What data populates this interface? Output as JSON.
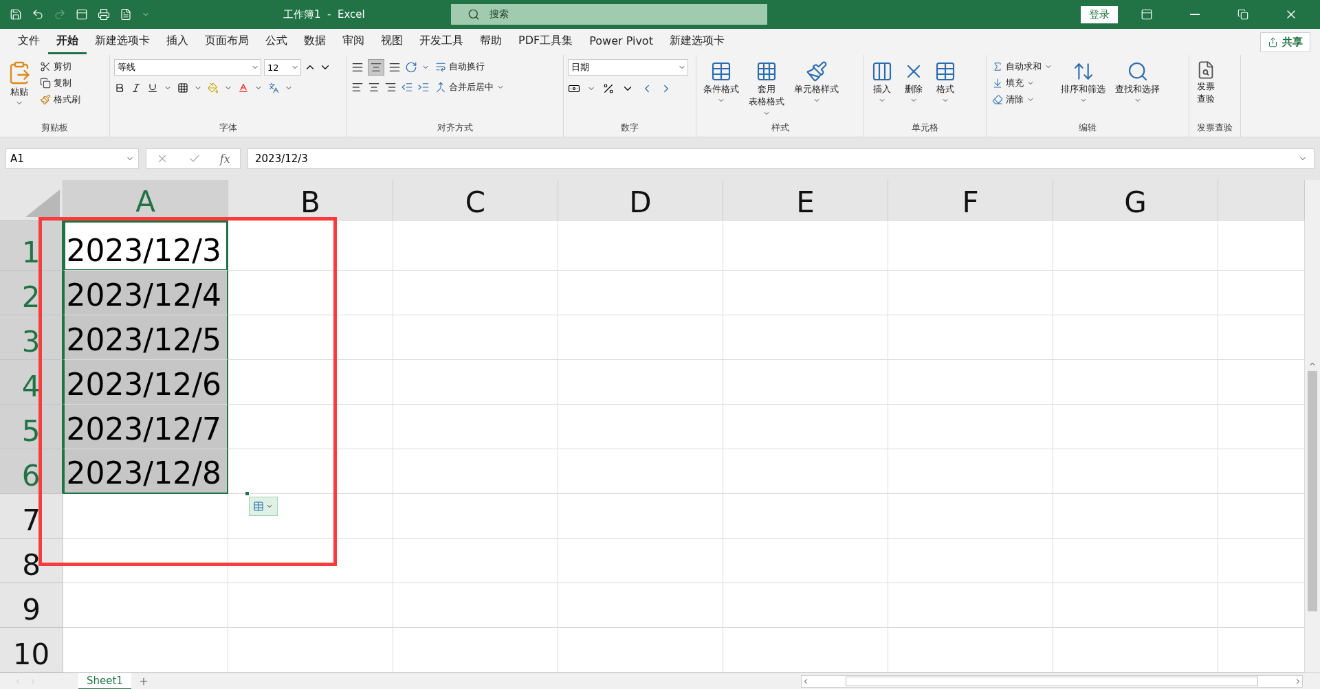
{
  "window": {
    "title": "工作簿1  -  Excel",
    "search": {
      "placeholder": "搜索"
    },
    "login": "登录"
  },
  "menu_tabs": [
    {
      "label": "文件",
      "selected": false
    },
    {
      "label": "开始",
      "selected": true
    },
    {
      "label": "新建选项卡",
      "selected": false
    },
    {
      "label": "插入",
      "selected": false
    },
    {
      "label": "页面布局",
      "selected": false
    },
    {
      "label": "公式",
      "selected": false
    },
    {
      "label": "数据",
      "selected": false
    },
    {
      "label": "审阅",
      "selected": false
    },
    {
      "label": "视图",
      "selected": false
    },
    {
      "label": "开发工具",
      "selected": false
    },
    {
      "label": "帮助",
      "selected": false
    },
    {
      "label": "PDF工具集",
      "selected": false
    },
    {
      "label": "Power Pivot",
      "selected": false
    },
    {
      "label": "新建选项卡",
      "selected": false
    }
  ],
  "share": "共享",
  "ribbon": {
    "clipboard": {
      "label": "剪贴板",
      "paste": "粘贴",
      "items": [
        "剪切",
        "复制",
        "格式刷"
      ]
    },
    "font": {
      "label": "字体",
      "font_name": "等线",
      "font_size": "12"
    },
    "alignment": {
      "label": "对齐方式",
      "wrap": "自动换行",
      "merge": "合并后居中"
    },
    "number": {
      "label": "数字",
      "format": "日期"
    },
    "styles": {
      "label": "样式",
      "items": [
        {
          "lines": [
            "条件格式"
          ],
          "kind": "conditional"
        },
        {
          "lines": [
            "套用",
            "表格格式"
          ],
          "kind": "table"
        },
        {
          "lines": [
            "单元格样式"
          ],
          "kind": "cellstyle"
        }
      ]
    },
    "cells": {
      "label": "单元格",
      "items": [
        {
          "label": "插入",
          "kind": "insert"
        },
        {
          "label": "删除",
          "kind": "delete"
        },
        {
          "label": "格式",
          "kind": "format"
        }
      ]
    },
    "editing": {
      "label": "编辑",
      "small": [
        {
          "label": "自动求和",
          "kind": "sum"
        },
        {
          "label": "填充",
          "kind": "fill"
        },
        {
          "label": "清除",
          "kind": "clear"
        }
      ],
      "large": [
        {
          "label": "排序和筛选",
          "kind": "sort"
        },
        {
          "label": "查找和选择",
          "kind": "find"
        }
      ]
    },
    "invoice": {
      "label": "发票查验",
      "button_lines": [
        "发票",
        "查验"
      ]
    }
  },
  "formula_bar": {
    "name_box": "A1",
    "fx": "fx",
    "value": "2023/12/3"
  },
  "columns": [
    {
      "label": "A",
      "selected": true
    },
    {
      "label": "B",
      "selected": false
    },
    {
      "label": "C",
      "selected": false
    },
    {
      "label": "D",
      "selected": false
    },
    {
      "label": "E",
      "selected": false
    },
    {
      "label": "F",
      "selected": false
    },
    {
      "label": "G",
      "selected": false
    }
  ],
  "rows": [
    {
      "header": "1",
      "selected": true,
      "active": true,
      "cells": [
        "2023/12/3"
      ]
    },
    {
      "header": "2",
      "selected": true,
      "active": false,
      "cells": [
        "2023/12/4"
      ]
    },
    {
      "header": "3",
      "selected": true,
      "active": false,
      "cells": [
        "2023/12/5"
      ]
    },
    {
      "header": "4",
      "selected": true,
      "active": false,
      "cells": [
        "2023/12/6"
      ]
    },
    {
      "header": "5",
      "selected": true,
      "active": false,
      "cells": [
        "2023/12/7"
      ]
    },
    {
      "header": "6",
      "selected": true,
      "active": false,
      "cells": [
        "2023/12/8"
      ]
    },
    {
      "header": "7",
      "selected": false,
      "active": false,
      "cells": []
    },
    {
      "header": "8",
      "selected": false,
      "active": false,
      "cells": []
    },
    {
      "header": "9",
      "selected": false,
      "active": false,
      "cells": []
    },
    {
      "header": "10",
      "selected": false,
      "active": false,
      "cells": []
    }
  ],
  "sheets": [
    {
      "label": "Sheet1",
      "selected": true
    }
  ],
  "annotations": [
    {
      "kind": "frame"
    }
  ]
}
